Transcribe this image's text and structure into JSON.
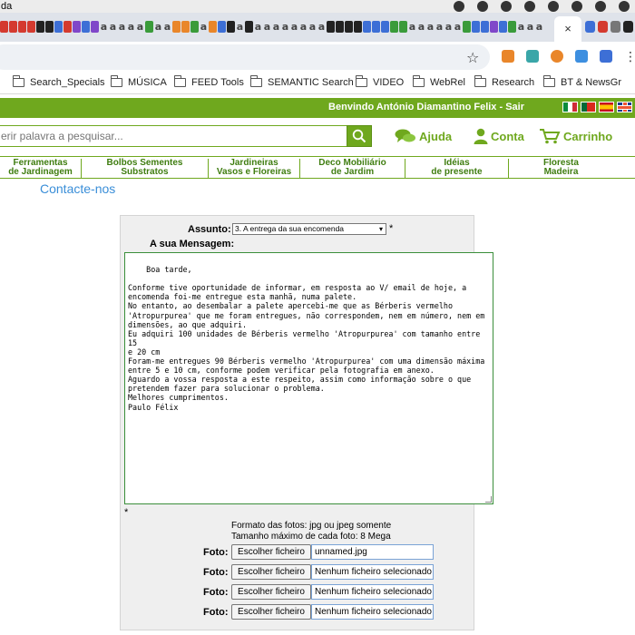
{
  "browser": {
    "app_title": "da",
    "tab_close": "×",
    "star": "☆",
    "menu": "⋮"
  },
  "bookmarks": [
    {
      "label": "Search_Specials"
    },
    {
      "label": "MÚSICA"
    },
    {
      "label": "FEED Tools"
    },
    {
      "label": "SEMANTIC Search"
    },
    {
      "label": "VIDEO"
    },
    {
      "label": "WebRel"
    },
    {
      "label": "Research"
    },
    {
      "label": "BT & NewsGr"
    }
  ],
  "site": {
    "welcome": "Benvindo António Diamantino Felix - Sair",
    "search_placeholder": "erir palavra a pesquisar...",
    "help": "Ajuda",
    "account": "Conta",
    "cart": "Carrinho",
    "accent_color": "#6fa81e",
    "categories": [
      {
        "line1": "Ferramentas",
        "line2": "de Jardinagem"
      },
      {
        "line1": "Bolbos Sementes",
        "line2": "Substratos"
      },
      {
        "line1": "Jardineiras",
        "line2": "Vasos e Floreiras"
      },
      {
        "line1": "Deco Mobiliário",
        "line2": "de Jardim"
      },
      {
        "line1": "Idéias",
        "line2": "de presente"
      },
      {
        "line1": "Floresta",
        "line2": "Madeira"
      }
    ],
    "page_title": "Contacte-nos"
  },
  "form": {
    "subject_label": "Assunto:",
    "subject_value": "3. A entrega da sua encomenda",
    "message_label": "A sua Mensagem:",
    "message": "Boa tarde,\n\nConforme tive oportunidade de informar, em resposta ao V/ email de hoje, a\nencomenda foi-me entregue esta manhã, numa palete.\nNo entanto, ao desembalar a palete apercebi-me que as Bérberis vermelho\n'Atropurpurea' que me foram entregues, não correspondem, nem em número, nem em\ndimensões, ao que adquiri.\nEu adquiri 100 unidades de Bérberis vermelho 'Atropurpurea' com tamanho entre 15\ne 20 cm\nForam-me entregues 90 Bérberis vermelho 'Atropurpurea' com uma dimensão máxima\nentre 5 e 10 cm, conforme podem verificar pela fotografia em anexo.\nAguardo a vossa resposta a este respeito, assim como informação sobre o que\npretendem fazer para solucionar o problema.\nMelhores cumprimentos.\nPaulo Félix",
    "required_mark": "*",
    "photo_format": "Formato das fotos: jpg ou jpeg somente",
    "photo_size": "Tamanho máximo de cada foto: 8 Mega",
    "photos": [
      {
        "label": "Foto:",
        "button": "Escolher ficheiro",
        "file": "unnamed.jpg"
      },
      {
        "label": "Foto:",
        "button": "Escolher ficheiro",
        "file": "Nenhum ficheiro selecionado"
      },
      {
        "label": "Foto:",
        "button": "Escolher ficheiro",
        "file": "Nenhum ficheiro selecionado"
      },
      {
        "label": "Foto:",
        "button": "Escolher ficheiro",
        "file": "Nenhum ficheiro selecionado"
      }
    ]
  }
}
